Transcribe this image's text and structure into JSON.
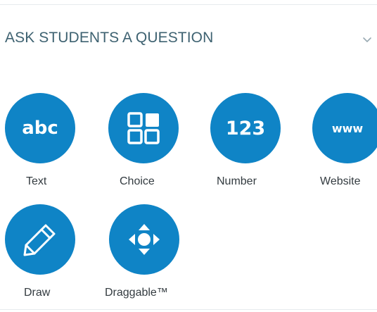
{
  "section": {
    "title": "ASK STUDENTS A QUESTION"
  },
  "colors": {
    "accent": "#0f84c6",
    "title": "#3e6271",
    "label": "#333b40",
    "divider": "#e6ebee"
  },
  "tiles": [
    {
      "label": "Text",
      "glyph": "abc",
      "icon": "text-icon"
    },
    {
      "label": "Choice",
      "icon": "choice-grid-icon"
    },
    {
      "label": "Number",
      "glyph": "123",
      "icon": "number-icon"
    },
    {
      "label": "Website",
      "glyph": "www",
      "icon": "website-icon"
    },
    {
      "label": "Draw",
      "icon": "pencil-icon"
    },
    {
      "label": "Draggable™",
      "icon": "move-arrows-icon"
    }
  ]
}
